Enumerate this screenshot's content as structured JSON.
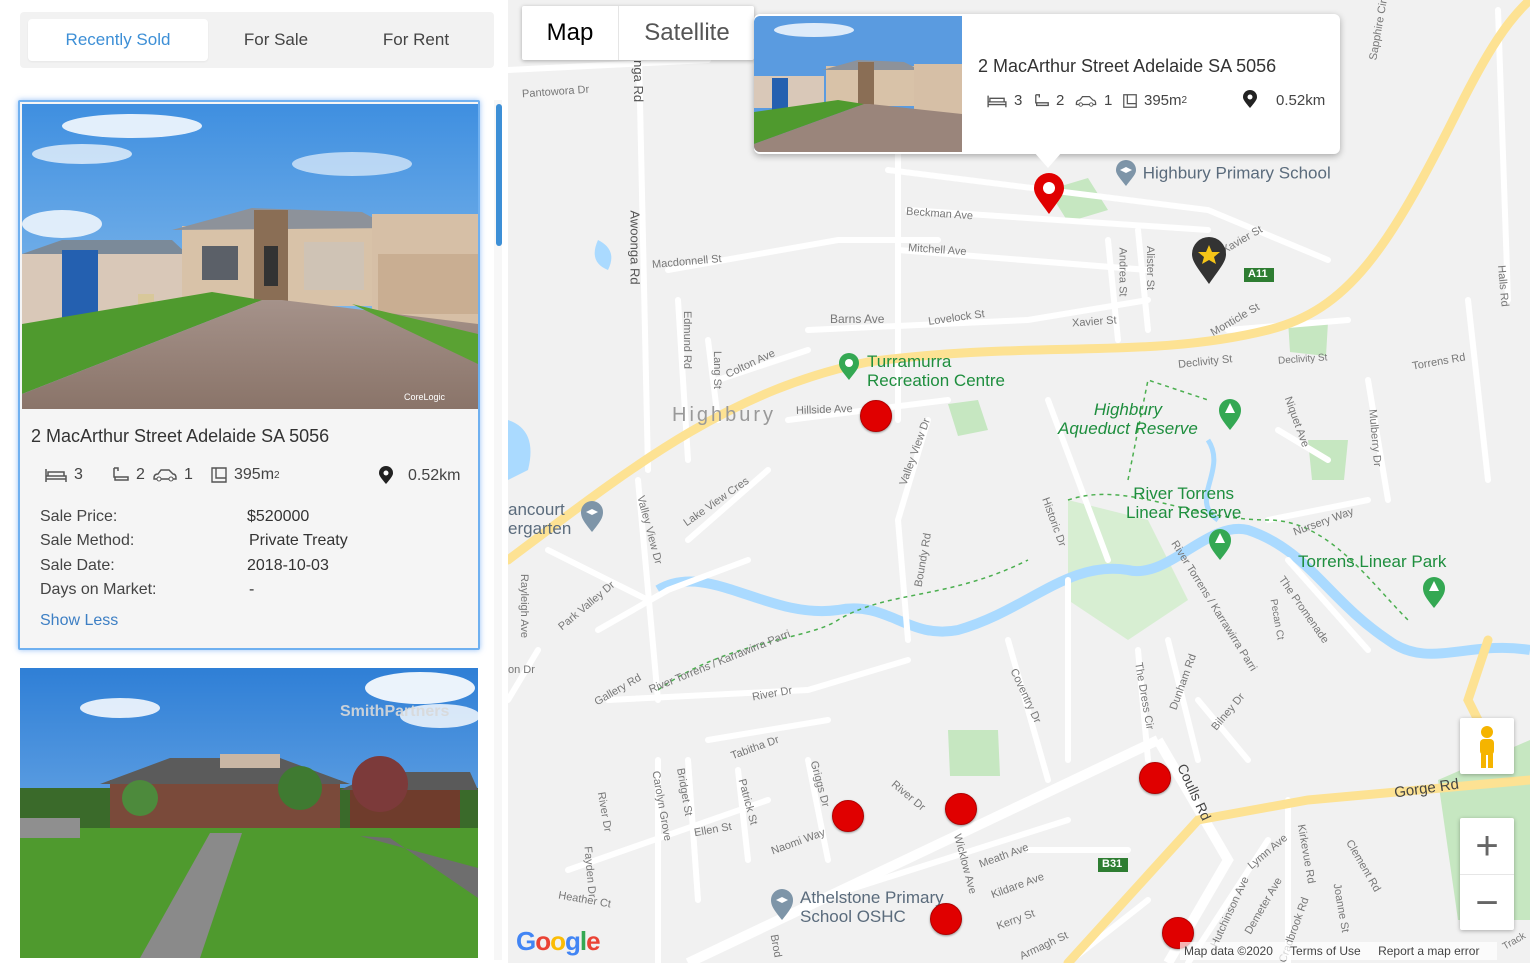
{
  "tabs": {
    "items": [
      "Recently Sold",
      "For Sale",
      "For Rent"
    ],
    "active": "Recently Sold"
  },
  "listing": {
    "address": "2 MacArthur Street Adelaide SA 5056",
    "beds": "3",
    "baths": "2",
    "cars": "1",
    "land": "395m",
    "land_sup": "2",
    "distance": "0.52km",
    "details": [
      {
        "label": "Sale Price:",
        "value": "$520000"
      },
      {
        "label": "Sale Method:",
        "value": "Private Treaty"
      },
      {
        "label": "Sale Date:",
        "value": "2018-10-03"
      },
      {
        "label": "Days on Market:",
        "value": "-"
      }
    ],
    "toggle_label": "Show Less",
    "photo_watermark": "CoreLogic"
  },
  "listing2": {
    "watermark": "SmithPartners"
  },
  "map": {
    "type_buttons": {
      "map": "Map",
      "satellite": "Satellite"
    },
    "active_type": "Map",
    "popup": {
      "address": "2 MacArthur Street Adelaide SA 5056",
      "beds": "3",
      "baths": "2",
      "cars": "1",
      "land": "395m",
      "land_sup": "2",
      "distance": "0.52km"
    },
    "places": {
      "school": "Highbury Primary School",
      "turramurra": [
        "Turramurra",
        "Recreation Centre"
      ],
      "aqueduct": [
        "Highbury",
        "Aqueduct Reserve"
      ],
      "river_torrens": [
        "River Torrens",
        "Linear Reserve"
      ],
      "torrens_park": "Torrens Linear Park",
      "athelstone": [
        "Athelstone Primary",
        "School OSHC"
      ],
      "kindergarten": [
        "ancourt",
        "ergarten"
      ],
      "suburb": "Highbury"
    },
    "streets": {
      "pantowora": "Pantowora Dr",
      "awoonga": "Awoonga Rd",
      "onga": "onga Rd",
      "macdonnell": "Macdonnell St",
      "beckman": "Beckman Ave",
      "mitchell": "Mitchell Ave",
      "barns": "Barns Ave",
      "lovelock": "Lovelock St",
      "xavier": "Xavier St",
      "xavier2": "Xavier St",
      "andrea": "Andrea St",
      "alister": "Alister St",
      "montacute": "Monticle St",
      "declivity": "Declivity St",
      "declivity2": "Declivity St",
      "torrens_rd": "Torrens Rd",
      "colton": "Colton Ave",
      "lang": "Lang St",
      "edmund": "Edmund Rd",
      "hillside": "Hillside Ave",
      "valleyview": "Valley View Dr",
      "lakeview": "Lake View Cres",
      "boundy": "Boundy Rd",
      "historic": "Historic Dr",
      "parkvalley": "Park Valley Dr",
      "rayleigh": "Rayleigh Ave",
      "valleyview2": "Valley View Dr",
      "rivertorrens_path": "River Torrens / Karrawirra Parri",
      "rivertorrens_path2": "River Torrens / Karrawirra Parri",
      "gallery": "Gallery Rd",
      "river": "River Dr",
      "tabitha": "Tabitha Dr",
      "coventry": "Coventry Dr",
      "nursery": "Nursery Way",
      "promenade": "The Promenade",
      "pecan": "Pecan Ct",
      "niquet": "Niquet Ave",
      "mulberry": "Mulberry Dr",
      "halls": "Halls Rd",
      "sapphire": "Sapphire Cir",
      "dresscir": "The Dress Cir",
      "dunham": "Dunham Rd",
      "bilney": "Bilney Dr",
      "coulls": "Coulls Rd",
      "gorge": "Gorge Rd",
      "carolyn": "Carolyn Grove",
      "bridget": "Bridget St",
      "patrick": "Patrick St",
      "griggs": "Griggs Dr",
      "riverdr2": "River Dr",
      "ellen": "Ellen St",
      "naomi": "Naomi Way",
      "wicklow": "Wicklow Ave",
      "meath": "Meath Ave",
      "kildare": "Kildare Ave",
      "kerry": "Kerry St",
      "armagh": "Armagh St",
      "lymn": "Lymn Ave",
      "demeter": "Demeter Ave",
      "kirkevue": "Kirkevue Rd",
      "clement": "Clement Rd",
      "joanne": "Joanne St",
      "hutchinson": "Hutchinson Ave",
      "cradbrook": "Cradbrook Rd",
      "heather": "Heather Ct",
      "fayden": "Fayden Dr",
      "riverdr3": "River Dr",
      "onr": "on Dr",
      "brod": "Brod",
      "a11": "A11",
      "b31": "B31",
      "track": "Track"
    },
    "attribution": [
      "Map data ©2020",
      "Terms of Use",
      "Report a map error"
    ],
    "logo": "Google",
    "zoom_in": "+",
    "zoom_out": "−"
  },
  "colors": {
    "accent": "#3d8fd6",
    "marker": "#e00000",
    "road_major": "#fde293",
    "water": "#aadaff",
    "park": "#c6e7c1"
  }
}
